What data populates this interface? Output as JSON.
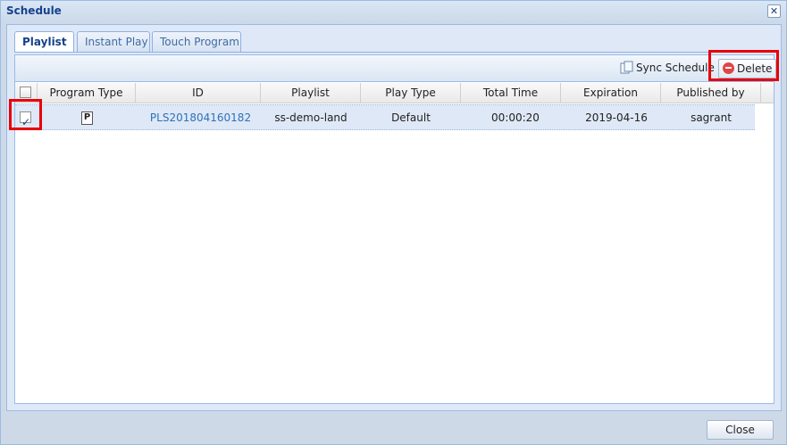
{
  "window": {
    "title": "Schedule"
  },
  "tabs": [
    {
      "label": "Playlist",
      "active": true
    },
    {
      "label": "Instant Play",
      "active": false
    },
    {
      "label": "Touch Program",
      "active": false
    }
  ],
  "toolbar": {
    "sync_label": "Sync Schedule",
    "delete_label": "Delete"
  },
  "table": {
    "columns": [
      "Program Type",
      "ID",
      "Playlist",
      "Play Type",
      "Total Time",
      "Expiration",
      "Published by"
    ],
    "rows": [
      {
        "checked": true,
        "program_type_icon": "playlist-document-icon",
        "id": "PLS201804160182",
        "playlist": "ss-demo-land",
        "play_type": "Default",
        "total_time": "00:00:20",
        "expiration": "2019-04-16",
        "published_by": "sagrant"
      }
    ]
  },
  "footer": {
    "close_label": "Close"
  },
  "colors": {
    "highlight_box": "#e8000b",
    "link": "#2c72b8",
    "title": "#15428b"
  }
}
